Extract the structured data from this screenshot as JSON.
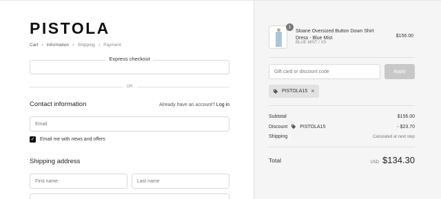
{
  "brand": {
    "logo": "PISTOLA"
  },
  "breadcrumb": [
    {
      "label": "Cart",
      "active": true
    },
    {
      "label": "Information",
      "active": true
    },
    {
      "label": "Shipping",
      "active": false
    },
    {
      "label": "Payment",
      "active": false
    }
  ],
  "express": {
    "label": "Express checkout",
    "or": "OR"
  },
  "contact": {
    "title": "Contact information",
    "have_account": "Already have an account?",
    "login": "Log in",
    "email_placeholder": "Email",
    "newsletter_label": "Email me with news and offers",
    "newsletter_checked": true
  },
  "shipping": {
    "title": "Shipping address",
    "first_name_placeholder": "First name",
    "last_name_placeholder": "Last name"
  },
  "order": {
    "quantity": "1",
    "product_name": "Sloane Oversized Button Down Shirt Dress - Blue Mist",
    "variant": "BLUE MIST / XS",
    "price": "$156.00",
    "gift_placeholder": "Gift card or discount code",
    "apply_label": "Apply",
    "discount_code": "PISTOLA15",
    "subtotal_label": "Subtotal",
    "subtotal_value": "$156.00",
    "discount_label": "Discount",
    "discount_value": "- $23.70",
    "shipping_label": "Shipping",
    "shipping_value": "Calculated at next step",
    "total_label": "Total",
    "currency": "USD",
    "total_value": "$134.30"
  },
  "colors": {
    "accent": "#111111",
    "panel_bg": "#f5f5f5",
    "apply_disabled": "#c8c8c8"
  },
  "icons": {
    "tag": "tag-icon",
    "close": "close-icon",
    "chevron": "chevron-right-icon",
    "check": "checkmark-icon"
  }
}
